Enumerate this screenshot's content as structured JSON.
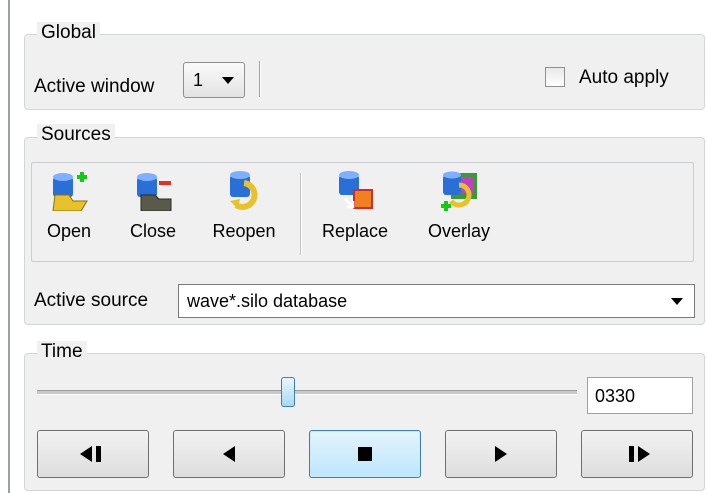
{
  "global": {
    "title": "Global",
    "active_window_label": "Active window",
    "active_window_value": "1",
    "auto_apply_label": "Auto apply",
    "auto_apply_checked": false
  },
  "sources": {
    "title": "Sources",
    "tools": [
      {
        "label": "Open",
        "icon": "open-database-icon"
      },
      {
        "label": "Close",
        "icon": "close-database-icon"
      },
      {
        "label": "Reopen",
        "icon": "reopen-database-icon"
      },
      {
        "label": "Replace",
        "icon": "replace-database-icon"
      },
      {
        "label": "Overlay",
        "icon": "overlay-database-icon"
      }
    ],
    "active_source_label": "Active source",
    "active_source_value": "wave*.silo database"
  },
  "time": {
    "title": "Time",
    "value": "0330",
    "slider_fraction": 0.47,
    "buttons": [
      {
        "icon": "step-back-icon"
      },
      {
        "icon": "play-reverse-icon"
      },
      {
        "icon": "stop-icon",
        "active": true
      },
      {
        "icon": "play-icon"
      },
      {
        "icon": "step-forward-icon"
      }
    ]
  },
  "colors": {
    "panel": "#f0f0f0",
    "database_blue": "#2a6fd6",
    "folder_yellow": "#e8c22c",
    "add_green": "#19c619",
    "remove_red": "#e03030",
    "active_button": "#bde6fd"
  }
}
